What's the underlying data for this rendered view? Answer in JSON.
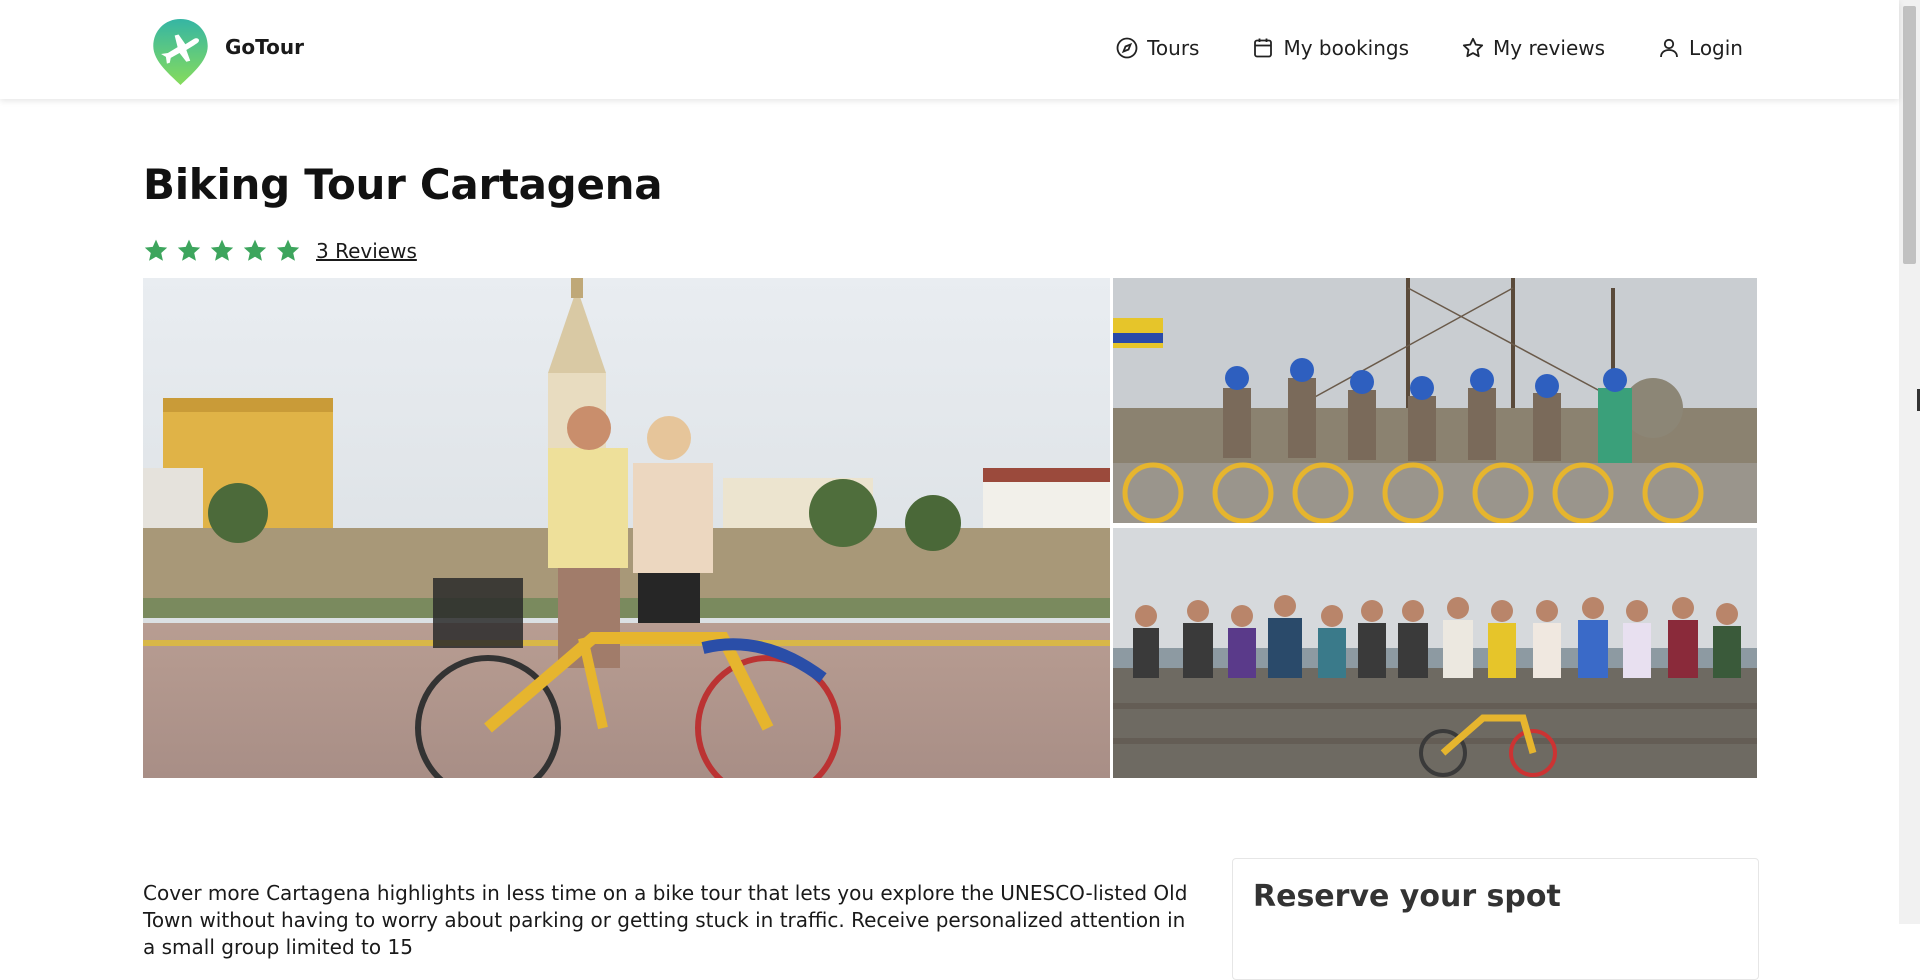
{
  "header": {
    "brand": "GoTour",
    "nav": [
      {
        "label": "Tours",
        "icon": "compass-icon"
      },
      {
        "label": "My bookings",
        "icon": "calendar-icon"
      },
      {
        "label": "My reviews",
        "icon": "star-outline-icon"
      },
      {
        "label": "Login",
        "icon": "user-icon"
      }
    ]
  },
  "tour": {
    "title": "Biking Tour Cartagena",
    "rating_stars": 5,
    "reviews_label": "3 Reviews",
    "description": "Cover more Cartagena highlights in less time on a bike tour that lets you explore the UNESCO-listed Old Town without having to worry about parking or getting stuck in traffic. Receive personalized attention in a small group limited to 15"
  },
  "gallery": {
    "main_image": "couple-with-bicycle-photo",
    "side_images": [
      "group-cyclists-at-harbor-photo",
      "group-on-city-wall-photo"
    ]
  },
  "reserve": {
    "title": "Reserve your spot"
  },
  "colors": {
    "star": "#3da55d",
    "logo_top": "#3cb8a0",
    "logo_bottom": "#7ed957"
  }
}
